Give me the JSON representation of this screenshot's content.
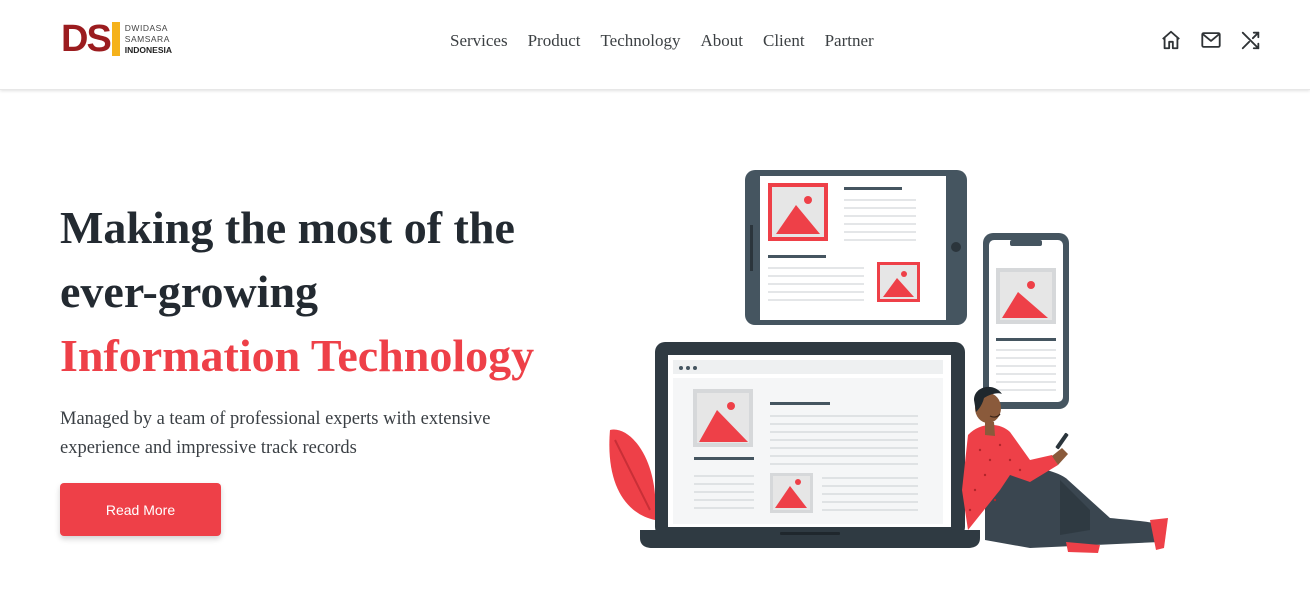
{
  "brand": {
    "mark": "DS",
    "line1": "DWIDASA",
    "line2": "SAMSARA",
    "line3": "INDONESIA",
    "colors": {
      "primary": "#9b1c1f",
      "accent": "#f5b21b"
    }
  },
  "nav": {
    "items": [
      {
        "label": "Services"
      },
      {
        "label": "Product"
      },
      {
        "label": "Technology"
      },
      {
        "label": "About"
      },
      {
        "label": "Client"
      },
      {
        "label": "Partner"
      }
    ]
  },
  "header_icons": [
    "home-icon",
    "mail-icon",
    "shuffle-icon"
  ],
  "hero": {
    "title_line1": "Making the most of the",
    "title_line2": "ever-growing",
    "title_accent": "Information Technology",
    "subtitle": "Managed by a team of professional experts with extensive experience and impressive track records",
    "cta_label": "Read More"
  },
  "theme": {
    "accent": "#ee4048",
    "dark": "#232a31",
    "device": "#455560"
  }
}
